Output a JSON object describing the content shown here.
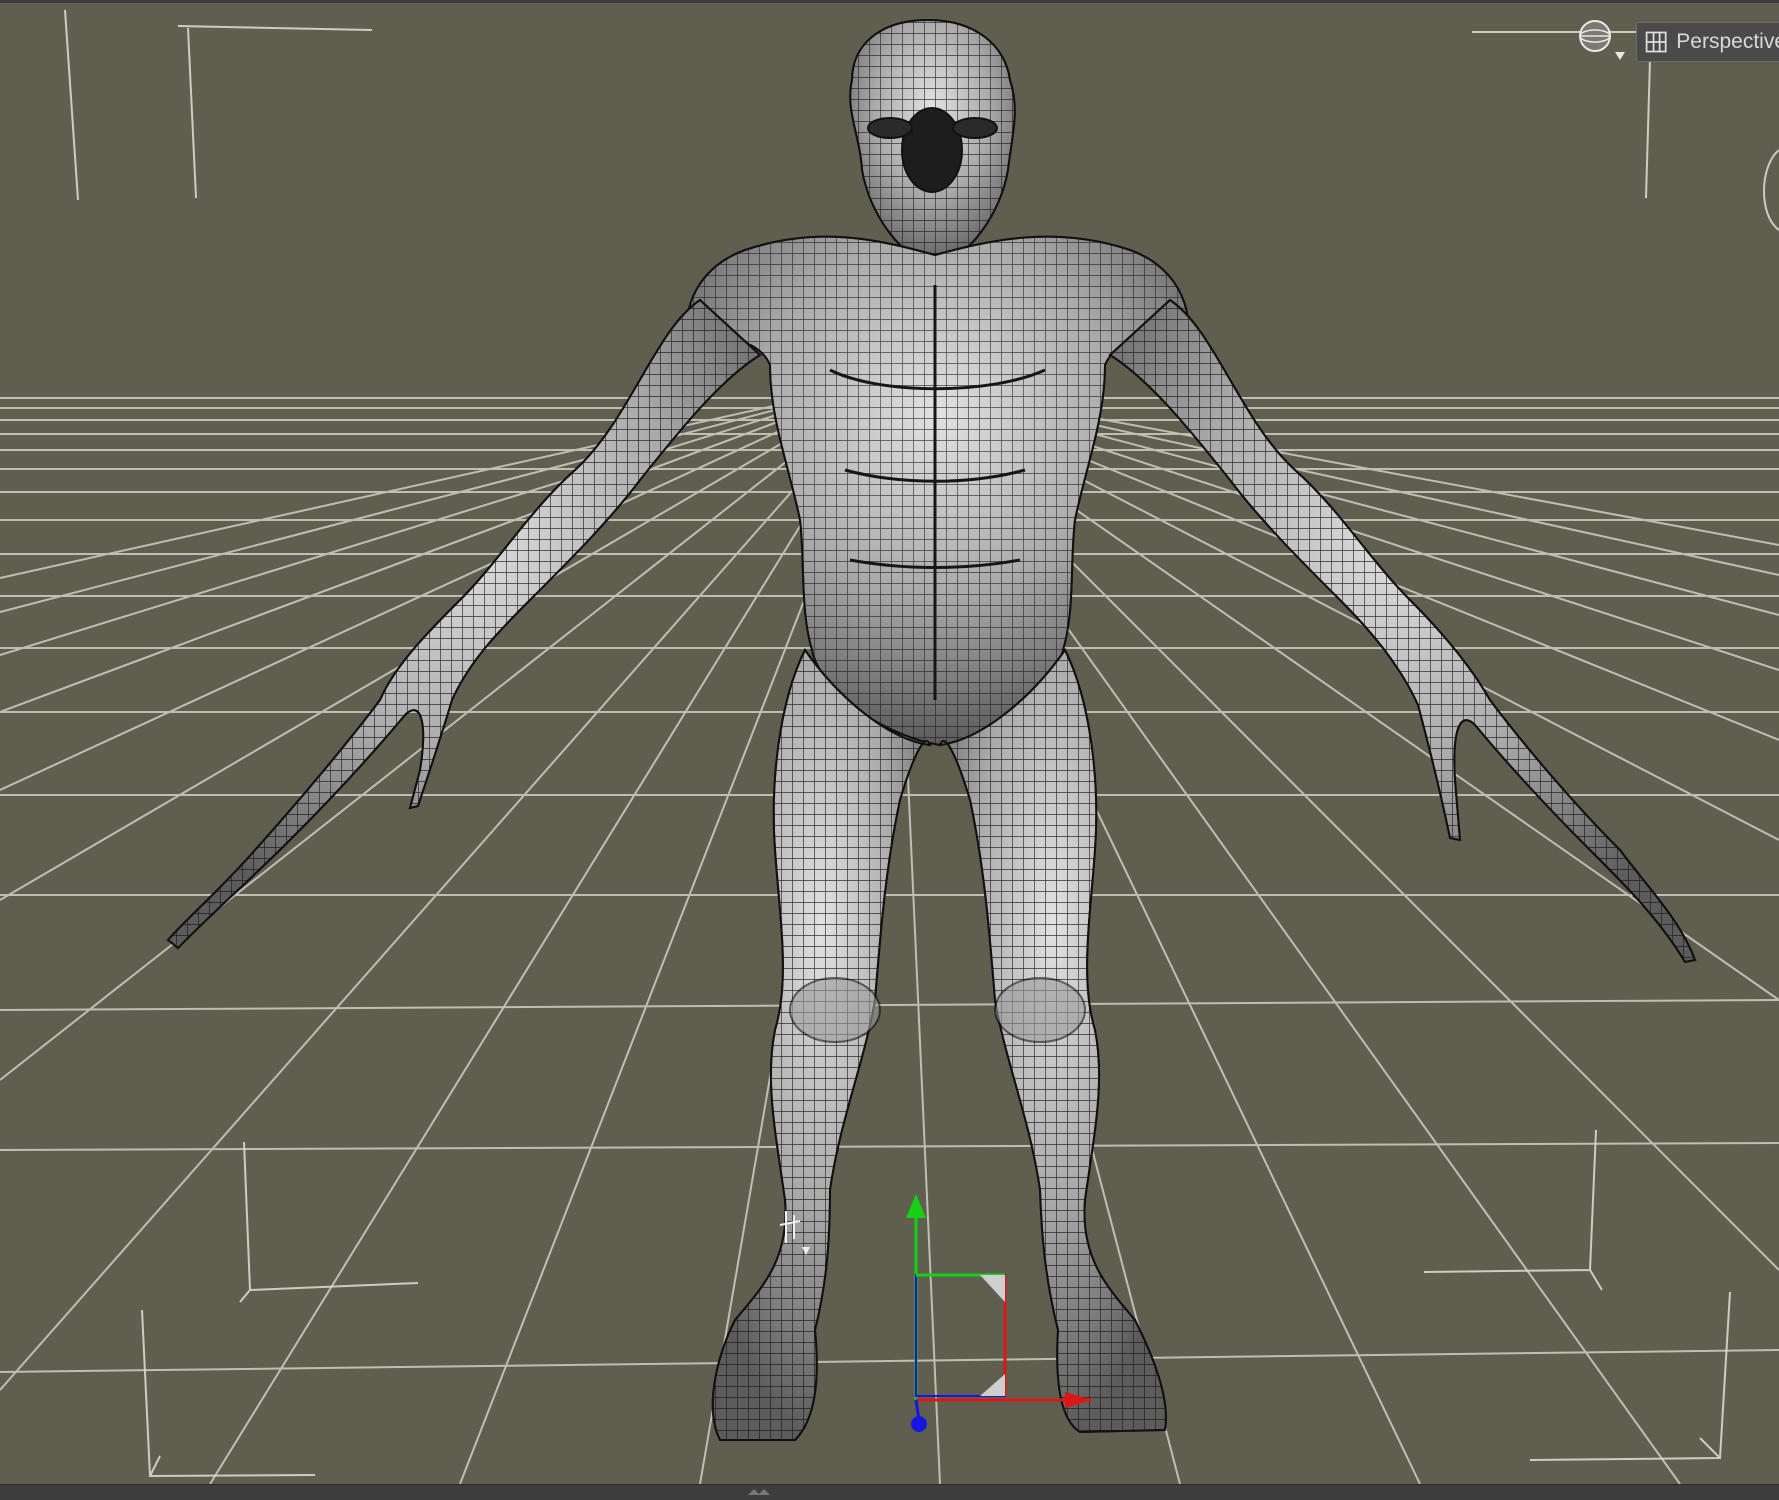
{
  "viewport": {
    "camera_label": "Perspective",
    "background_color": "#5f5f50",
    "grid_color": "#c9c9c0"
  },
  "gizmo": {
    "axis_colors": {
      "x": "#e01616",
      "y": "#16d016",
      "z": "#1616e0"
    }
  },
  "icons": {
    "view_widget": "globe-camera-icon",
    "view_layout": "viewport-layout-icon",
    "pivot": "pivot-marker-icon"
  }
}
